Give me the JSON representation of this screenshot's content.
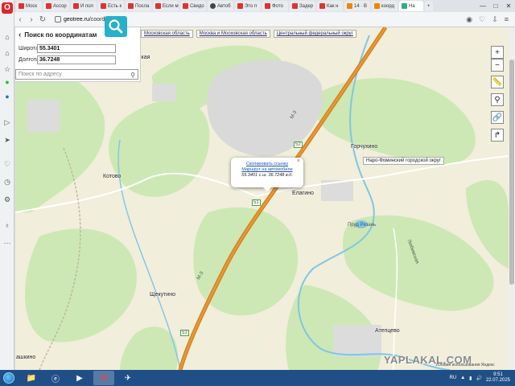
{
  "browser": {
    "tabs": [
      {
        "label": "Моск",
        "fav": "r"
      },
      {
        "label": "Ассор",
        "fav": "r"
      },
      {
        "label": "И пол",
        "fav": "r"
      },
      {
        "label": "Есть к",
        "fav": "r"
      },
      {
        "label": "Посла",
        "fav": "r"
      },
      {
        "label": "Если м",
        "fav": "r"
      },
      {
        "label": "Свидо",
        "fav": "r"
      },
      {
        "label": "Автоб",
        "fav": "k"
      },
      {
        "label": "Это п",
        "fav": "r"
      },
      {
        "label": "Фото",
        "fav": "r"
      },
      {
        "label": "Задер",
        "fav": "r"
      },
      {
        "label": "Как н",
        "fav": "r"
      },
      {
        "label": "14 · В",
        "fav": "o"
      },
      {
        "label": "коорд",
        "fav": "o"
      },
      {
        "label": "На",
        "fav": "g",
        "active": true
      }
    ],
    "url_domain": "geotree.ru",
    "url_path": "/coordinates"
  },
  "panel": {
    "title": "Поиск по координатам",
    "lat_label": "Широта",
    "lat_value": "55.3401",
    "lon_label": "Долгота",
    "lon_value": "36.7248",
    "address_placeholder": "Поиск по адресу"
  },
  "regions": [
    "Московская область",
    "Москва и Московская область",
    "Центральный федеральный округ"
  ],
  "popup": {
    "copy_link": "Скопировать ссылку",
    "route": "Маршрут на автомобиле",
    "coords": "55.3401 с.ш. 36.7248 в.д."
  },
  "map_labels": {
    "kotovo": "Котово",
    "elagino": "Елагино",
    "gorchukhino": "Горчухино",
    "shchekutino": "Щекутино",
    "atepcevo": "Атепцево",
    "ashkino": "ашкино",
    "skaya": "ская",
    "region_tip": "Наро-Фоминский городской округ",
    "road_m3": "М-3",
    "shield_1": "52",
    "shield_2": "51",
    "shield_3": "53",
    "pond": "Пруд Рязань",
    "street": "Любимская",
    "zoom_in": "+",
    "zoom_out": "−"
  },
  "watermark": "YAPLAKAL.COM",
  "attribution": "Условия использования Яндекс",
  "taskbar": {
    "lang": "RU",
    "time": "9:51",
    "date": "22.07.2025"
  },
  "colors": {
    "road": "#e8962e",
    "forest": "#cde8b4",
    "field": "#f1eedb",
    "urban": "#d9d9d9",
    "river": "#7fc6e5",
    "accent": "#27b0c9"
  }
}
